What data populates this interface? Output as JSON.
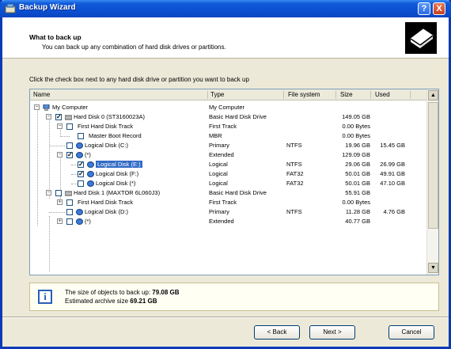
{
  "window": {
    "title": "Backup Wizard",
    "help_label": "?",
    "close_label": "X"
  },
  "header": {
    "title": "What to back up",
    "subtitle": "You can back up any combination of hard disk drives or partitions."
  },
  "instruction": "Click the check box next to any hard disk drive or partition you want to back up",
  "columns": [
    "Name",
    "Type",
    "File system",
    "Size",
    "Used"
  ],
  "rows": [
    {
      "name": "My Computer",
      "type": "My Computer",
      "fs": "",
      "size": "",
      "used": ""
    },
    {
      "name": "Hard Disk 0 (ST3160023A)",
      "type": "Basic Hard Disk Drive",
      "fs": "",
      "size": "149.05 GB",
      "used": ""
    },
    {
      "name": "First Hard Disk Track",
      "type": "First Track",
      "fs": "",
      "size": "0.00 Bytes",
      "used": ""
    },
    {
      "name": "Master Boot Record",
      "type": "MBR",
      "fs": "",
      "size": "0.00 Bytes",
      "used": ""
    },
    {
      "name": "Logical Disk (C:)",
      "type": "Primary",
      "fs": "NTFS",
      "size": "19.96 GB",
      "used": "15.45 GB"
    },
    {
      "name": "(*)",
      "type": "Extended",
      "fs": "",
      "size": "129.09 GB",
      "used": ""
    },
    {
      "name": "Logical Disk (E:)",
      "type": "Logical",
      "fs": "NTFS",
      "size": "29.06 GB",
      "used": "26.99 GB"
    },
    {
      "name": "Logical Disk (F:)",
      "type": "Logical",
      "fs": "FAT32",
      "size": "50.01 GB",
      "used": "49.91 GB"
    },
    {
      "name": "Logical Disk (*)",
      "type": "Logical",
      "fs": "FAT32",
      "size": "50.01 GB",
      "used": "47.10 GB"
    },
    {
      "name": "Hard Disk 1 (MAXTOR 6L060J3)",
      "type": "Basic Hard Disk Drive",
      "fs": "",
      "size": "55.91 GB",
      "used": ""
    },
    {
      "name": "First Hard Disk Track",
      "type": "First Track",
      "fs": "",
      "size": "0.00 Bytes",
      "used": ""
    },
    {
      "name": "Logical Disk (D:)",
      "type": "Primary",
      "fs": "NTFS",
      "size": "11.28 GB",
      "used": "4.76 GB"
    },
    {
      "name": "(*)",
      "type": "Extended",
      "fs": "",
      "size": "40.77 GB",
      "used": ""
    }
  ],
  "info": {
    "line1_label": "The size of objects to back up:",
    "line1_value": "79.08 GB",
    "line2_label": "Estimated archive size",
    "line2_value": "69.21 GB"
  },
  "buttons": {
    "back": "< Back",
    "next": "Next >",
    "cancel": "Cancel"
  },
  "scrollbar": {
    "up": "▲",
    "down": "▼"
  },
  "colors": {
    "title_bar": "#0b4ecf",
    "selection": "#316ac5"
  }
}
